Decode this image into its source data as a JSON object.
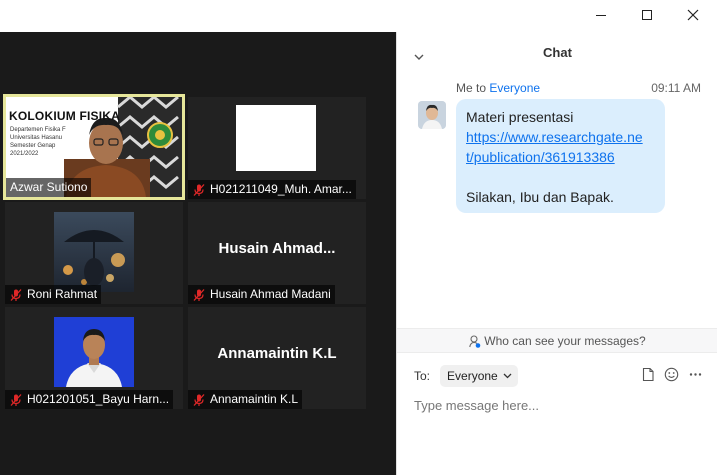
{
  "window": {
    "controls": [
      "minimize",
      "maximize",
      "close"
    ]
  },
  "participants": [
    {
      "name": "Azwar Sutiono",
      "muted": false,
      "active_speaker": true,
      "video": "slide",
      "slide": {
        "title": "KOLOKIUM FISIKA",
        "lines": [
          "Departemen Fisika F",
          "Universitas Hasanu",
          "Semester Genap",
          "2021/2022"
        ]
      }
    },
    {
      "name": "H021211049_Muh. Amar...",
      "muted": true,
      "video": "blank"
    },
    {
      "name": "Roni Rahmat",
      "muted": true,
      "video": "photo"
    },
    {
      "name": "Husain Ahmad Madani",
      "muted": true,
      "video": "off",
      "display_name": "Husain  Ahmad..."
    },
    {
      "name": "H021201051_Bayu Harn...",
      "muted": true,
      "video": "portrait"
    },
    {
      "name": "Annamaintin K.L",
      "muted": true,
      "video": "off",
      "display_name": "Annamaintin K.L"
    }
  ],
  "chat": {
    "title": "Chat",
    "message": {
      "sender_prefix": "Me to ",
      "recipient": "Everyone",
      "time": "09:11 AM",
      "line1": "Materi presentasi",
      "link": "https://www.researchgate.net/publication/361913386",
      "link_part1": "https://www.researchgate.ne",
      "link_part2": "t/publication/361913386",
      "line3": "Silakan, Ibu dan Bapak."
    },
    "who_can_see": "Who can see your messages?",
    "to_label": "To:",
    "to_value": "Everyone",
    "input_placeholder": "Type message here..."
  },
  "colors": {
    "accent": "#0e72ed",
    "bubble": "#dbeefd",
    "active_border": "#e6e69a",
    "muted_icon": "#e02828",
    "video_bg": "#1a1a1a"
  }
}
